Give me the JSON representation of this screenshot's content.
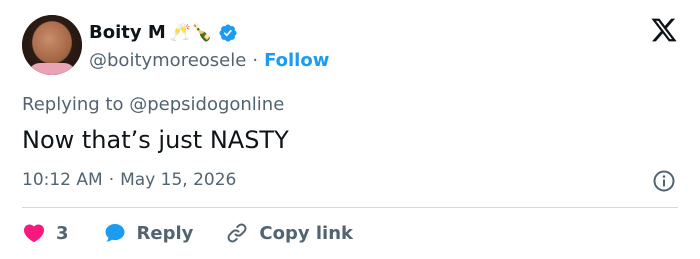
{
  "author": {
    "name": "Boity M",
    "name_emojis": "🥂🍾",
    "handle": "@boitymoreosele",
    "separator": "·",
    "follow_label": "Follow"
  },
  "reply_context": {
    "prefix": "Replying to",
    "handle": "@pepsidogonline"
  },
  "tweet": {
    "text": "Now that’s just NASTY",
    "time": "10:12 AM",
    "separator": "·",
    "date": "May 15, 2026"
  },
  "actions": {
    "like_count": "3",
    "reply_label": "Reply",
    "copy_link_label": "Copy link"
  },
  "colors": {
    "accent": "#1d9bf0",
    "like": "#f91880",
    "text_secondary": "#536471",
    "text_primary": "#0f1419",
    "divider": "#cfd9de"
  },
  "icons": {
    "verified": "verified-badge-icon",
    "brand": "x-logo-icon",
    "info": "info-icon",
    "like": "heart-icon",
    "reply": "speech-bubble-icon",
    "copy": "link-icon"
  }
}
